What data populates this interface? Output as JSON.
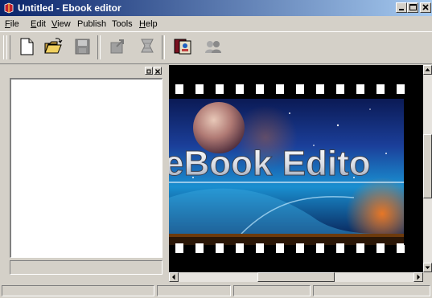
{
  "window": {
    "title": "Untitled - Ebook editor",
    "controls": [
      "minimize-icon",
      "maximize-icon",
      "close-icon"
    ]
  },
  "menu": [
    {
      "label": "File",
      "mnemonic": "F",
      "rest": "ile"
    },
    {
      "label": "Edit",
      "mnemonic": "E",
      "rest": "dit"
    },
    {
      "label": "View",
      "mnemonic": "V",
      "rest": "iew"
    },
    {
      "label": "Publish",
      "mnemonic": "",
      "rest": "Publish"
    },
    {
      "label": "Tools",
      "mnemonic": "",
      "rest": "Tools"
    },
    {
      "label": "Help",
      "mnemonic": "H",
      "rest": "elp"
    }
  ],
  "toolbar": {
    "buttons": [
      "new-document-icon",
      "open-folder-icon",
      "save-disk-icon",
      "export-icon",
      "upload-icon",
      "preview-book-icon",
      "users-icon"
    ],
    "enabled": [
      true,
      true,
      false,
      false,
      false,
      true,
      false
    ]
  },
  "preview": {
    "banner_text": "eBook Edito",
    "colors": {
      "film": "#000000",
      "sky_top": "#12256b",
      "sky_bottom": "#1a8fd0",
      "accent": "#ff7a1a"
    }
  },
  "colors": {
    "face": "#d4d0c8",
    "title_start": "#0a246a",
    "title_end": "#a6caf0"
  }
}
